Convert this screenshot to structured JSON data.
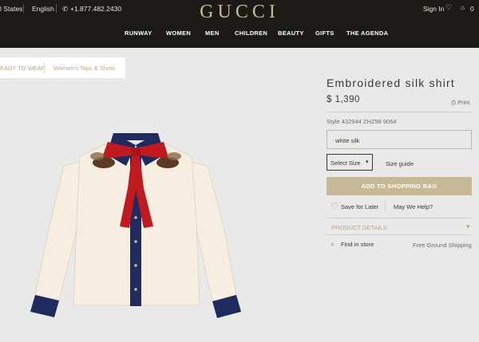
{
  "header": {
    "country": "l States",
    "language": "English",
    "phone": "+1.877.482.2430",
    "logo": "GUCCI",
    "sign_in": "Sign In",
    "bag_count": "0",
    "nav": [
      "RUNWAY",
      "WOMEN",
      "MEN",
      "CHILDREN",
      "BEAUTY",
      "GIFTS",
      "THE AGENDA"
    ]
  },
  "breadcrumb": [
    "EADY TO WEAR",
    "Women's Tops & Shirts"
  ],
  "product": {
    "title": "Embroidered silk shirt",
    "price": "$ 1,390",
    "print_label": "Print",
    "style_number": "Style 432944 ZHZ98 9064",
    "color": "white silk",
    "size_select": "Select Size",
    "size_guide": "Size guide",
    "add_to_bag": "ADD TO SHOPPING BAG",
    "save_for_later": "Save for Later",
    "help": "May We Help?",
    "details": "PRODUCT DETAILS",
    "find_in_store": "Find in store",
    "shipping": "Free Ground Shipping"
  },
  "colors": {
    "header_bg": "#1c1a17",
    "logo_gold": "#c8b98f",
    "accent_gold": "#c5b997",
    "navy": "#1f2a5e",
    "red": "#c0191f",
    "cream": "#f6eee1"
  },
  "icons": [
    "phone-icon",
    "heart-icon",
    "bag-icon",
    "printer-icon",
    "location-pin-icon",
    "chevron-down-icon"
  ]
}
